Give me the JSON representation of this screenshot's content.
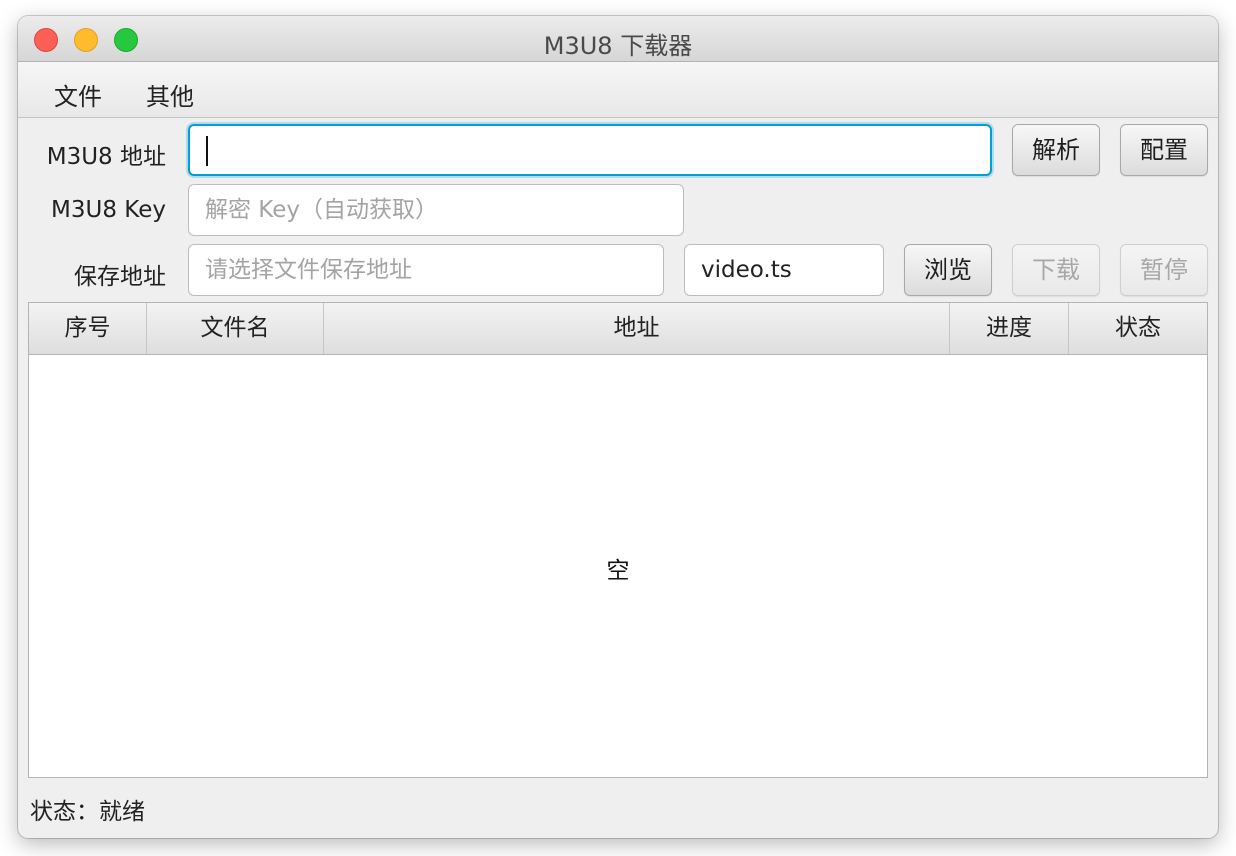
{
  "window": {
    "title": "M3U8 下载器"
  },
  "menu": {
    "file": "文件",
    "other": "其他"
  },
  "form": {
    "url_label": "M3U8 地址",
    "url_value": "",
    "key_label": "M3U8  Key",
    "key_placeholder": "解密 Key（自动获取）",
    "save_label": "保存地址",
    "save_placeholder": "请选择文件保存地址",
    "filename_value": "video.ts"
  },
  "buttons": {
    "parse": "解析",
    "config": "配置",
    "browse": "浏览",
    "download": "下载",
    "pause": "暂停"
  },
  "table": {
    "columns": [
      "序号",
      "文件名",
      "地址",
      "进度",
      "状态"
    ],
    "rows": [],
    "empty_text": "空"
  },
  "status": {
    "label": "状态：",
    "value": "就绪"
  },
  "colors": {
    "focus_ring": "#039ed3",
    "traffic_close": "#fd5f57",
    "traffic_minimize": "#febb2e",
    "traffic_maximize": "#27c840"
  }
}
